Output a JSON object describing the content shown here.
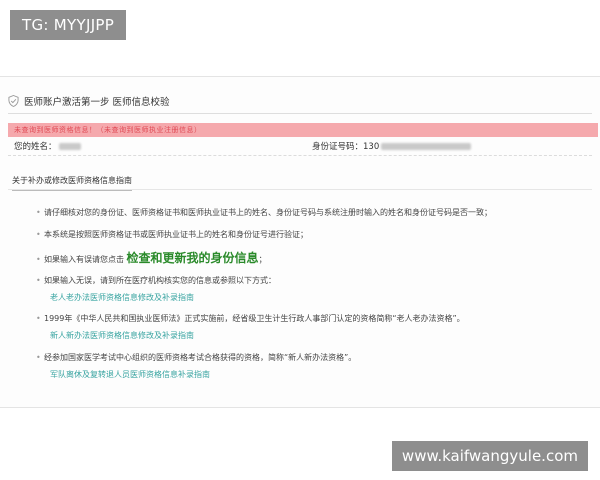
{
  "watermark_top": "TG: MYYJJPP",
  "watermark_bottom": "www.kaifwangyule.com",
  "header": {
    "title": "医师账户激活第一步 医师信息校验",
    "icon": "shield-check-icon"
  },
  "alert": {
    "text": "未查询到医师资格信息！（未查询到医师执业注册信息）"
  },
  "info": {
    "name_label": "您的姓名：",
    "id_label": "身份证号码：",
    "id_prefix": "130"
  },
  "guide": {
    "title": "关于补办或修改医师资格信息指南",
    "items": [
      {
        "text": "请仔细核对您的身份证、医师资格证书和医师执业证书上的姓名、身份证号码与系统注册时输入的姓名和身份证号码是否一致；"
      },
      {
        "text": "本系统是按照医师资格证书或医师执业证书上的姓名和身份证号进行验证；"
      },
      {
        "text_before": "如果输入有误请您点击",
        "highlight": "检查和更新我的身份信息",
        "text_after": "；"
      },
      {
        "text": "如果输入无误，请到所在医疗机构核实您的信息或参照以下方式：",
        "link": "老人老办法医师资格信息修改及补录指南"
      },
      {
        "text": "1999年《中华人民共和国执业医师法》正式实施前，经省级卫生计生行政人事部门认定的资格简称“老人老办法资格”。",
        "link": "新人新办法医师资格信息修改及补录指南"
      },
      {
        "text": "经参加国家医学考试中心组织的医师资格考试合格获得的资格，简称“新人新办法资格”。",
        "link": "军队离休及复转退人员医师资格信息补录指南"
      }
    ]
  }
}
